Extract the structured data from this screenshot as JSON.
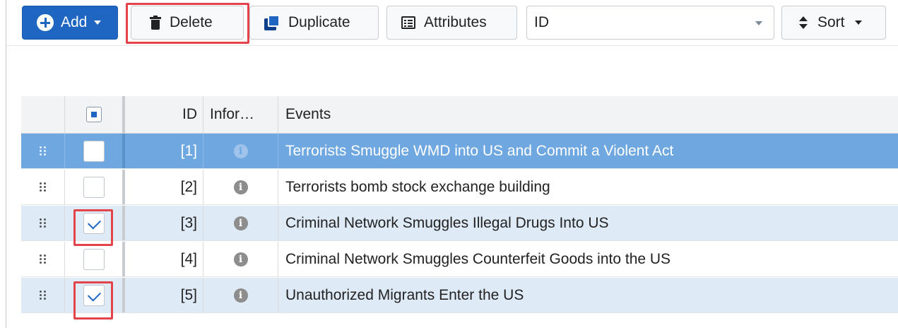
{
  "toolbar": {
    "add_label": "Add",
    "delete_label": "Delete",
    "duplicate_label": "Duplicate",
    "attributes_label": "Attributes",
    "field_select_value": "ID",
    "sort_label": "Sort"
  },
  "table": {
    "columns": [
      "ID",
      "Infor…",
      "Events"
    ],
    "rows": [
      {
        "id": "[1]",
        "event": "Terrorists Smuggle WMD into US and Commit a Violent Act",
        "checked": false,
        "state": "selected"
      },
      {
        "id": "[2]",
        "event": "Terrorists bomb stock exchange building",
        "checked": false,
        "state": "plain"
      },
      {
        "id": "[3]",
        "event": "Criminal Network Smuggles Illegal Drugs Into US",
        "checked": true,
        "state": "alt"
      },
      {
        "id": "[4]",
        "event": "Criminal Network Smuggles Counterfeit Goods into the US",
        "checked": false,
        "state": "plain"
      },
      {
        "id": "[5]",
        "event": "Unauthorized Migrants Enter the US",
        "checked": true,
        "state": "alt"
      }
    ]
  },
  "icons": {
    "info": "i"
  },
  "colors": {
    "primary": "#1f66c3",
    "selected_row": "#6fa8e0",
    "checked_row": "#dfeaf7",
    "highlight": "#e3434b"
  }
}
